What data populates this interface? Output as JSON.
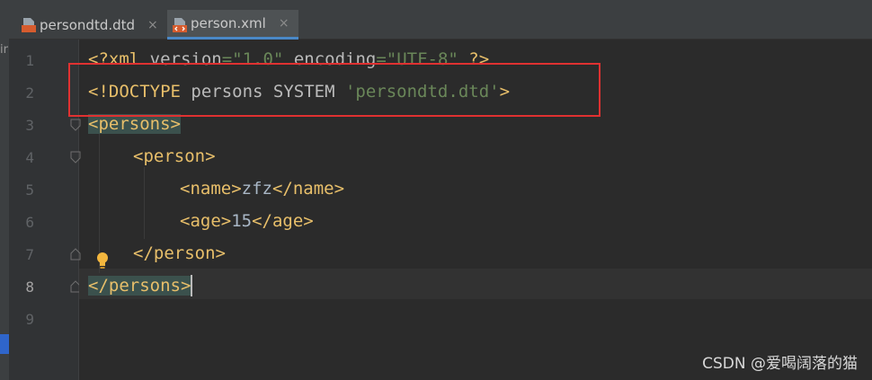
{
  "tabs": [
    {
      "label": "persondtd.dtd",
      "icon": "dtd-file-icon",
      "active": false,
      "icon_text": "DTD"
    },
    {
      "label": "person.xml",
      "icon": "xml-file-icon",
      "active": true,
      "icon_text": "<>"
    }
  ],
  "close_glyph": "×",
  "side_text": "ir",
  "line_numbers": [
    "1",
    "2",
    "3",
    "4",
    "5",
    "6",
    "7",
    "8",
    "9"
  ],
  "current_line": "8",
  "code": {
    "l1": {
      "open": "<?xml ",
      "attr1": "version",
      "eq1": "=",
      "val1": "\"1.0\"",
      "attr2": " encoding",
      "eq2": "=",
      "val2": "\"UTF-8\"",
      "close": " ?>"
    },
    "l2": {
      "open": "<!DOCTYPE ",
      "name": "persons SYSTEM ",
      "val": "'persondtd.dtd'",
      "close": ">"
    },
    "l3": {
      "tag": "<persons>"
    },
    "l4": {
      "tag": "<person>"
    },
    "l5": {
      "open": "<name>",
      "text": "zfz",
      "close": "</name>"
    },
    "l6": {
      "open": "<age>",
      "text": "15",
      "close": "</age>"
    },
    "l7": {
      "tag": "</person>"
    },
    "l8": {
      "tag": "</persons>"
    }
  },
  "watermark": "CSDN @爱喝阔落的猫"
}
